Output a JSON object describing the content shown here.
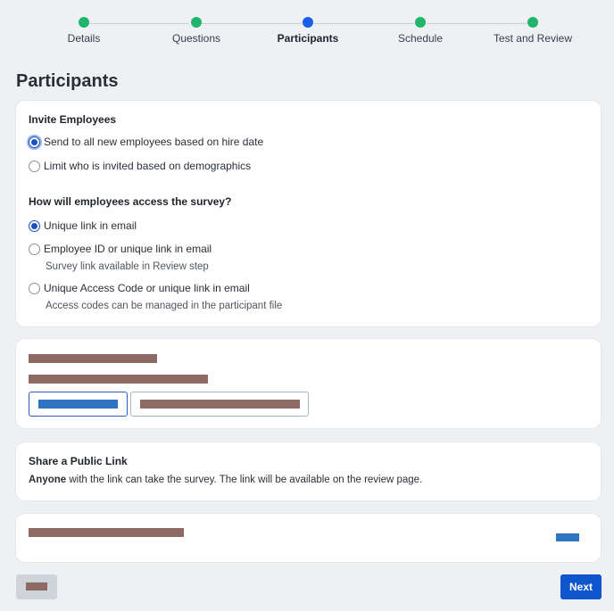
{
  "stepper": {
    "steps": [
      {
        "label": "Details",
        "state": "complete"
      },
      {
        "label": "Questions",
        "state": "complete"
      },
      {
        "label": "Participants",
        "state": "current"
      },
      {
        "label": "Schedule",
        "state": "complete"
      },
      {
        "label": "Test and Review",
        "state": "complete"
      }
    ]
  },
  "page_title": "Participants",
  "invite": {
    "title": "Invite Employees",
    "options": [
      {
        "label": "Send to all new employees based on hire date",
        "selected": true
      },
      {
        "label": "Limit who is invited based on demographics",
        "selected": false
      }
    ]
  },
  "access": {
    "title": "How will employees access the survey?",
    "options": [
      {
        "label": "Unique link in email",
        "selected": true,
        "note": ""
      },
      {
        "label": "Employee ID or unique link in email",
        "selected": false,
        "note": "Survey link available in Review step"
      },
      {
        "label": "Unique Access Code or unique link in email",
        "selected": false,
        "note": "Access codes can be managed in the participant file"
      }
    ]
  },
  "share": {
    "title": "Share a Public Link",
    "bold_word": "Anyone",
    "text": " with the link can take the survey. The link will be available on the review page."
  },
  "footer": {
    "next_label": "Next"
  },
  "colors": {
    "accent": "#0f55cc",
    "complete_step": "#1fb66b",
    "current_step": "#1a5fe6",
    "redacted": "#8d6b64",
    "redacted_link": "#2f74c0"
  }
}
